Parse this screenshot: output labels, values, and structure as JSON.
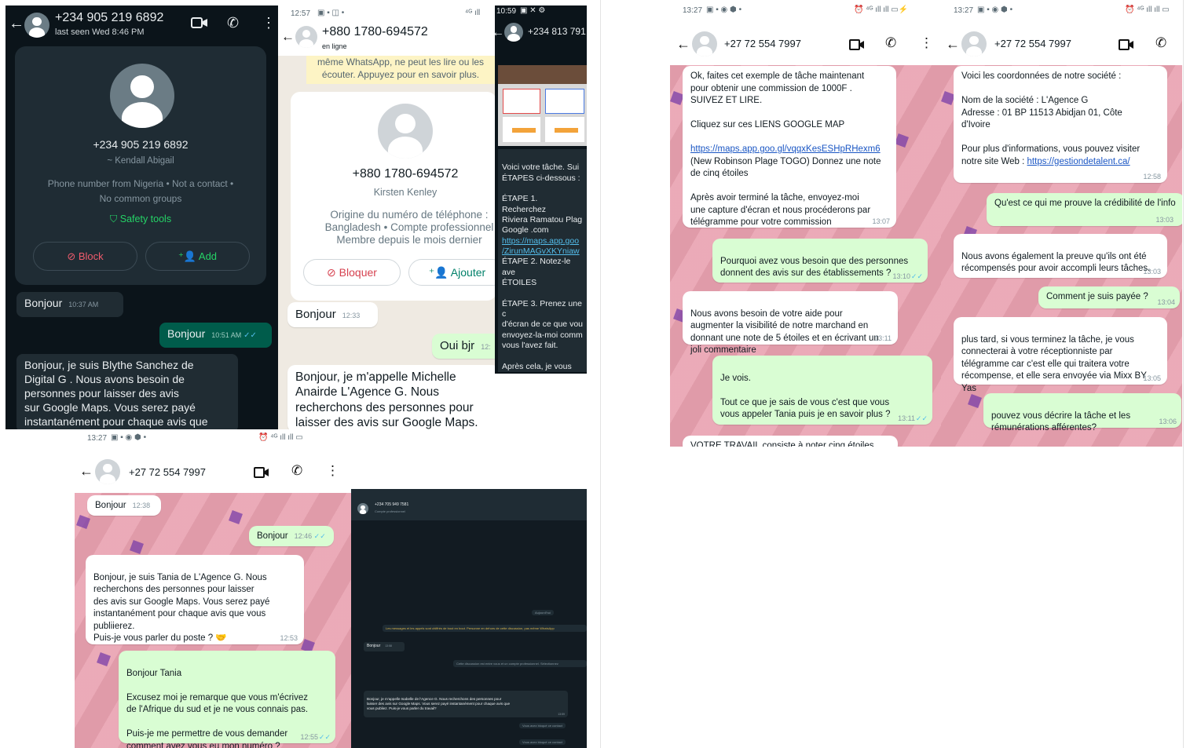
{
  "p1": {
    "phone": "+234 905 219 6892",
    "last_seen": "last seen Wed 8:46 PM",
    "card_phone": "+234 905 219 6892",
    "card_name": "~ Kendall Abigail",
    "card_info": "Phone number from Nigeria • Not a contact •\nNo common groups",
    "safety": "Safety tools",
    "block": "Block",
    "add": "Add",
    "in1": "Bonjour",
    "in1_time": "10:37 AM",
    "out1": "Bonjour",
    "out1_time": "10:51 AM",
    "in2": "Bonjour, je suis Blythe Sanchez de\nDigital G . Nous avons besoin de\npersonnes pour laisser des avis\nsur Google Maps. Vous serez payé\ninstantanément pour chaque avis que"
  },
  "p2": {
    "status_time": "12:57",
    "phone": "+880 1780-694572",
    "status": "en ligne",
    "banner": "même WhatsApp, ne peut les lire ou les\nécouter. Appuyez pour en savoir plus.",
    "card_phone": "+880 1780-694572",
    "card_name": "Kirsten Kenley",
    "card_info": "Origine du numéro de téléphone :\nBangladesh • Compte professionnel\nMembre depuis le mois dernier",
    "block": "Bloquer",
    "add": "Ajouter",
    "in1": "Bonjour",
    "in1_time": "12:33",
    "out1": "Oui bjr",
    "out1_time": "12:",
    "in2": "Bonjour, je m'appelle Michelle\nAnairde L'Agence G. Nous\nrecherchons des personnes pour\nlaisser des avis sur Google Maps."
  },
  "p3": {
    "status_time": "10:59",
    "phone": "+234 813 791",
    "msg": "Voici votre tâche. Sui\nÉTAPES ci-dessous :\n\nÉTAPE 1. Recherchez\nRiviera Ramatou Plag\nGoogle .com",
    "link": "https://maps.app.goo\n/ZirunMAGvXKYniaw",
    "msg2": "ÉTAPE 2. Notez-le ave\nÉTOILES\n\nÉTAPE 3. Prenez une c\nd'écran de ce que vou\nenvoyez-la-moi comm\nvous l'avez fait.\n\nAprès cela, je vous me\ncontact avec notre réc\npour votre récompens\ncandidature. Merci !."
  },
  "p4": {
    "status_time": "13:27",
    "phone": "+27 72 554 7997",
    "in1": "Ok, faites cet exemple de tâche maintenant\npour obtenir une commission de 1000F .\nSUIVEZ ET LIRE.\n\nCliquez sur ces LIENS GOOGLE MAP",
    "link": "https://maps.app.goo.gl/vqqxKesESHpRHexm6",
    "in1b": "(New Robinson Plage TOGO) Donnez une note\nde cinq étoiles\n\nAprès avoir terminé la tâche, envoyez-moi\nune capture d'écran et nous procéderons par\ntélégramme pour votre commission",
    "in1_time": "13:07",
    "out1": "Pourquoi avez vous besoin que des personnes\ndonnent des avis sur des établissements ?",
    "out1_time": "13:10",
    "in2": "Nous avons besoin de votre aide pour\naugmenter la visibilité de notre marchand en\ndonnant une note de 5 étoiles et en écrivant un\njoli commentaire",
    "in2_time": "13:11",
    "out2": "Je vois.\n\nTout ce que je sais de vous c'est que vous\nvous appeler Tania puis je en savoir plus ?",
    "out2_time": "13:11",
    "in3": "VOTRE TRAVAIL consiste à noter cinq étoiles"
  },
  "p5": {
    "status_time": "13:27",
    "phone": "+27 72 554 7997",
    "in1": "Voici les coordonnées de notre société :\n\nNom de la société : L'Agence G\nAdresse : 01 BP 11513 Abidjan 01, Côte\nd'Ivoire\n\nPour plus d'informations, vous pouvez visiter\nnotre site Web :",
    "link": "https://gestiondetalent.ca/",
    "in1_time": "12:58",
    "out1": "Qu'est ce qui me prouve la crédibilité de l'info",
    "out1_time": "13:03",
    "in2": "Nous avons également la preuve qu'ils ont été\nrécompensés pour avoir accompli leurs tâches.",
    "in2_time": "13:03",
    "out2": "Comment je suis payée ?",
    "out2_time": "13:04",
    "in3": "plus tard, si vous terminez la tâche, je vous\nconnecterai à votre réceptionniste par\ntélégramme car c'est elle qui traitera votre\nrécompense, et elle sera envoyée via Mixx BY\nYas",
    "in3_time": "13:05",
    "out3": "pouvez vous décrire la tâche et les\nrémunérations afférentes?",
    "out3_time": "13:06"
  },
  "p6": {
    "status_time": "13:27",
    "phone": "+27 72 554 7997",
    "in1": "Bonjour",
    "in1_time": "12:38",
    "out1": "Bonjour",
    "out1_time": "12:46",
    "in2": "Bonjour, je suis Tania de L'Agence G. Nous\nrecherchons des personnes pour laisser\ndes avis sur Google Maps. Vous serez payé\ninstantanément pour chaque avis que vous\npubliierez.\nPuis-je vous parler du poste ? 🤝",
    "in2_time": "12:53",
    "out2": "Bonjour Tania\n\nExcusez moi je remarque que vous m'écrivez\nde l'Afrique du sud et je ne vous connais pas.\n\nPuis-je me permettre de vous demander\ncomment avez vous eu mon numéro ?",
    "out2_time": "12:55"
  },
  "p7": {
    "phone": "+234 705 949 7581",
    "status": "Compte professionnel",
    "date": "Aujourd'hui",
    "notice": "Les messages et les appels sont chiffrés de bout en bout. Personne en dehors de cette discussion, pas même WhatsApp",
    "in1": "Bonjour",
    "in1_time": "13:58",
    "business": "Cette discussion est entre vous et un compte professionnel. Sélectionnez",
    "in2": "Bonjour, je m'appelle Isabelle de l'Agence G. Nous recherchons des personnes pour\nlaisser des avis sur Google Maps. Vous serez payé instantanément pour chaque avis que\nvous publiez. Puis-je vous parler du travail?",
    "in2_time": "13:59",
    "sys1": "Vous avez bloqué ce contact",
    "sys2": "Vous avez bloqué ce contact"
  }
}
